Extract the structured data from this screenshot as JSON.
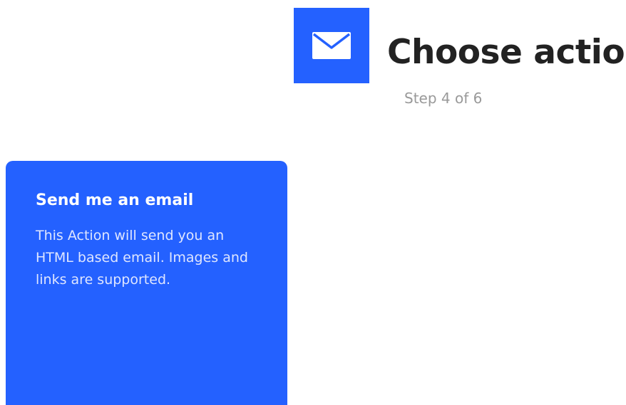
{
  "header": {
    "service_icon": "envelope-icon",
    "title": "Choose action",
    "step": "Step 4 of 6"
  },
  "actions": [
    {
      "title": "Send me an email",
      "description": "This Action will send you an HTML based email. Images and links are supported."
    }
  ],
  "colors": {
    "accent": "#2461ff",
    "title_text": "#222222",
    "muted_text": "#999999",
    "card_text": "#ffffff",
    "card_subtext": "#dfe6ff"
  }
}
